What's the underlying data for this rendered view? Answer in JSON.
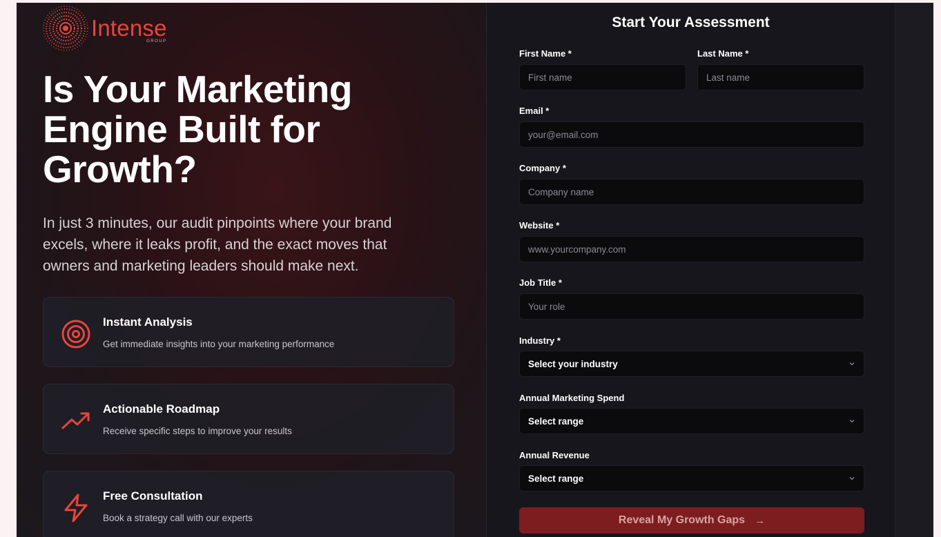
{
  "brand": {
    "name": "Intense",
    "sub": "GROUP",
    "accent": "#e8453c"
  },
  "hero": {
    "headline": "Is Your Marketing Engine Built for Growth?",
    "intro": "In just 3 minutes, our audit pinpoints where your brand excels, where it leaks profit, and the exact moves that owners and marketing leaders should make next."
  },
  "features": [
    {
      "icon": "target-icon",
      "title": "Instant Analysis",
      "desc": "Get immediate insights into your marketing performance"
    },
    {
      "icon": "trending-up-icon",
      "title": "Actionable Roadmap",
      "desc": "Receive specific steps to improve your results"
    },
    {
      "icon": "lightning-icon",
      "title": "Free Consultation",
      "desc": "Book a strategy call with our experts"
    }
  ],
  "form": {
    "title": "Start Your Assessment",
    "first_name": {
      "label": "First Name *",
      "placeholder": "First name",
      "value": ""
    },
    "last_name": {
      "label": "Last Name *",
      "placeholder": "Last name",
      "value": ""
    },
    "email": {
      "label": "Email *",
      "placeholder": "your@email.com",
      "value": ""
    },
    "company": {
      "label": "Company *",
      "placeholder": "Company name",
      "value": ""
    },
    "website": {
      "label": "Website *",
      "placeholder": "www.yourcompany.com",
      "value": ""
    },
    "job_title": {
      "label": "Job Title *",
      "placeholder": "Your role",
      "value": ""
    },
    "industry": {
      "label": "Industry *",
      "selected": "Select your industry"
    },
    "marketing_spend": {
      "label": "Annual Marketing Spend",
      "selected": "Select range"
    },
    "revenue": {
      "label": "Annual Revenue",
      "selected": "Select range"
    },
    "submit_label": "Reveal My Growth Gaps",
    "submit_arrow": "→"
  }
}
